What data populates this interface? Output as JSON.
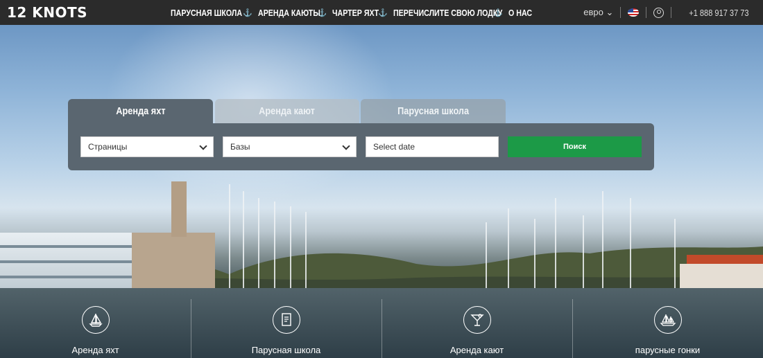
{
  "header": {
    "logo": "12 KNOTS",
    "nav": [
      {
        "label": "Парусная школа"
      },
      {
        "label": "Аренда каюты"
      },
      {
        "label": "Чартер яхт"
      },
      {
        "label": "Перечислите свою лодку"
      },
      {
        "label": "О нас"
      }
    ],
    "currency": "евро",
    "phone": "+1 888 917 37 73"
  },
  "search": {
    "tabs": [
      {
        "label": "Аренда яхт"
      },
      {
        "label": "Аренда кают"
      },
      {
        "label": "Парусная школа"
      }
    ],
    "country_select": "Страницы",
    "base_select": "Базы",
    "date_placeholder": "Select date",
    "submit_label": "Поиск"
  },
  "features": [
    {
      "label": "Аренда яхт",
      "icon": "sailboat-icon"
    },
    {
      "label": "Парусная школа",
      "icon": "certificate-icon"
    },
    {
      "label": "Аренда кают",
      "icon": "cocktail-icon"
    },
    {
      "label": "парусные гонки",
      "icon": "regatta-icon"
    }
  ],
  "colors": {
    "header_bg": "#2b2b2b",
    "panel_bg": "#5a6670",
    "search_button": "#1c9a47"
  }
}
